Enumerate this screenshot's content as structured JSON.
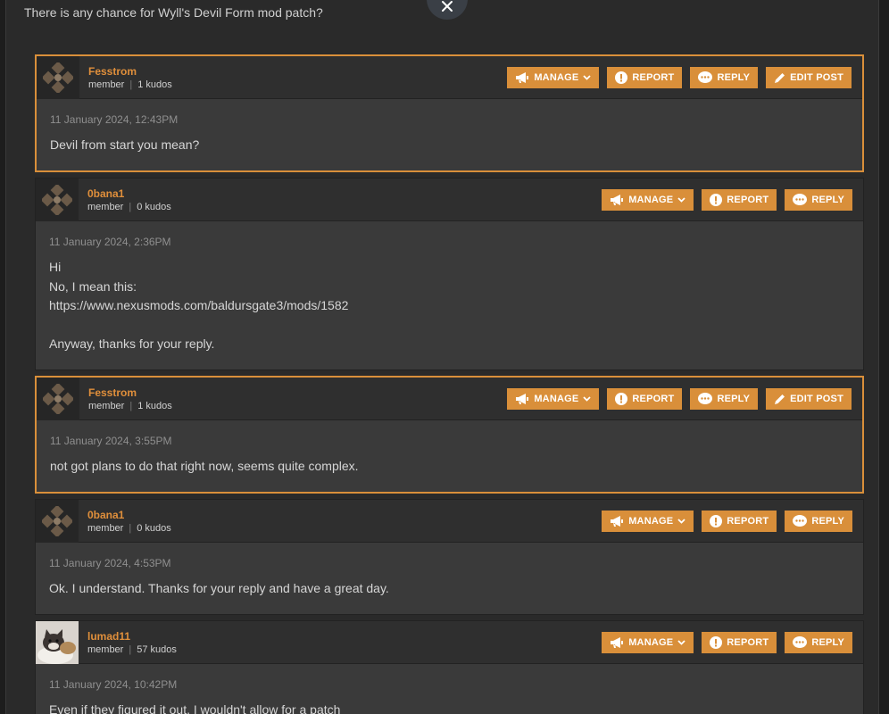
{
  "topic": {
    "intro_text": "There is any chance for Wyll's Devil Form mod patch?"
  },
  "labels": {
    "manage": "MANAGE",
    "report": "REPORT",
    "reply": "REPLY",
    "edit_post": "EDIT POST"
  },
  "posts": [
    {
      "username": "Fesstrom",
      "role": "member",
      "kudos": "1 kudos",
      "date": "11 January 2024, 12:43PM",
      "lines": [
        "Devil from start you mean?"
      ]
    },
    {
      "username": "0bana1",
      "role": "member",
      "kudos": "0 kudos",
      "date": "11 January 2024, 2:36PM",
      "lines": [
        "Hi",
        "No, I mean this:",
        "https://www.nexusmods.com/baldursgate3/mods/1582",
        "",
        "Anyway, thanks for your reply."
      ]
    },
    {
      "username": "Fesstrom",
      "role": "member",
      "kudos": "1 kudos",
      "date": "11 January 2024, 3:55PM",
      "lines": [
        "not got plans to do that right now, seems quite complex."
      ]
    },
    {
      "username": "0bana1",
      "role": "member",
      "kudos": "0 kudos",
      "date": "11 January 2024, 4:53PM",
      "lines": [
        "Ok. I understand. Thanks for your reply and have a great day."
      ]
    },
    {
      "username": "lumad11",
      "role": "member",
      "kudos": "57 kudos",
      "date": "11 January 2024, 10:42PM",
      "lines": [
        "Even if they figured it out, I wouldn't allow for a patch"
      ]
    }
  ],
  "colors": {
    "accent": "#d98f3a",
    "username": "#e08f3b",
    "post_bg": "#3a3a3a",
    "page_bg": "#2a2a2a"
  }
}
